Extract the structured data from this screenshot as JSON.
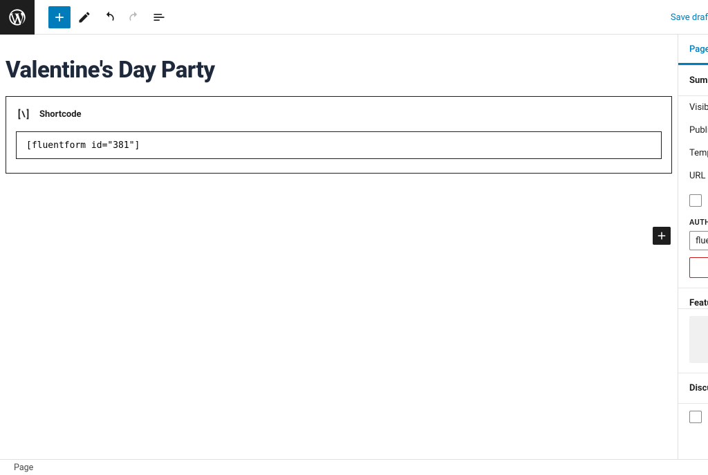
{
  "toolbar": {
    "save_draft_label": "Save draf"
  },
  "page": {
    "title": "Valentine's Day Party"
  },
  "shortcode_block": {
    "label": "Shortcode",
    "value": "[fluentform id=\"381\"]"
  },
  "sidebar": {
    "tabs": {
      "page": "Page"
    },
    "summary_label": "Summ",
    "rows": {
      "visibility": "Visibi",
      "publish": "Publis",
      "template": "Temp",
      "url": "URL"
    },
    "author_label": "AUTHO",
    "author_value": "fluen",
    "featured_label": "Featu",
    "discussion_label": "Discu"
  },
  "breadcrumb": {
    "label": "Page"
  }
}
